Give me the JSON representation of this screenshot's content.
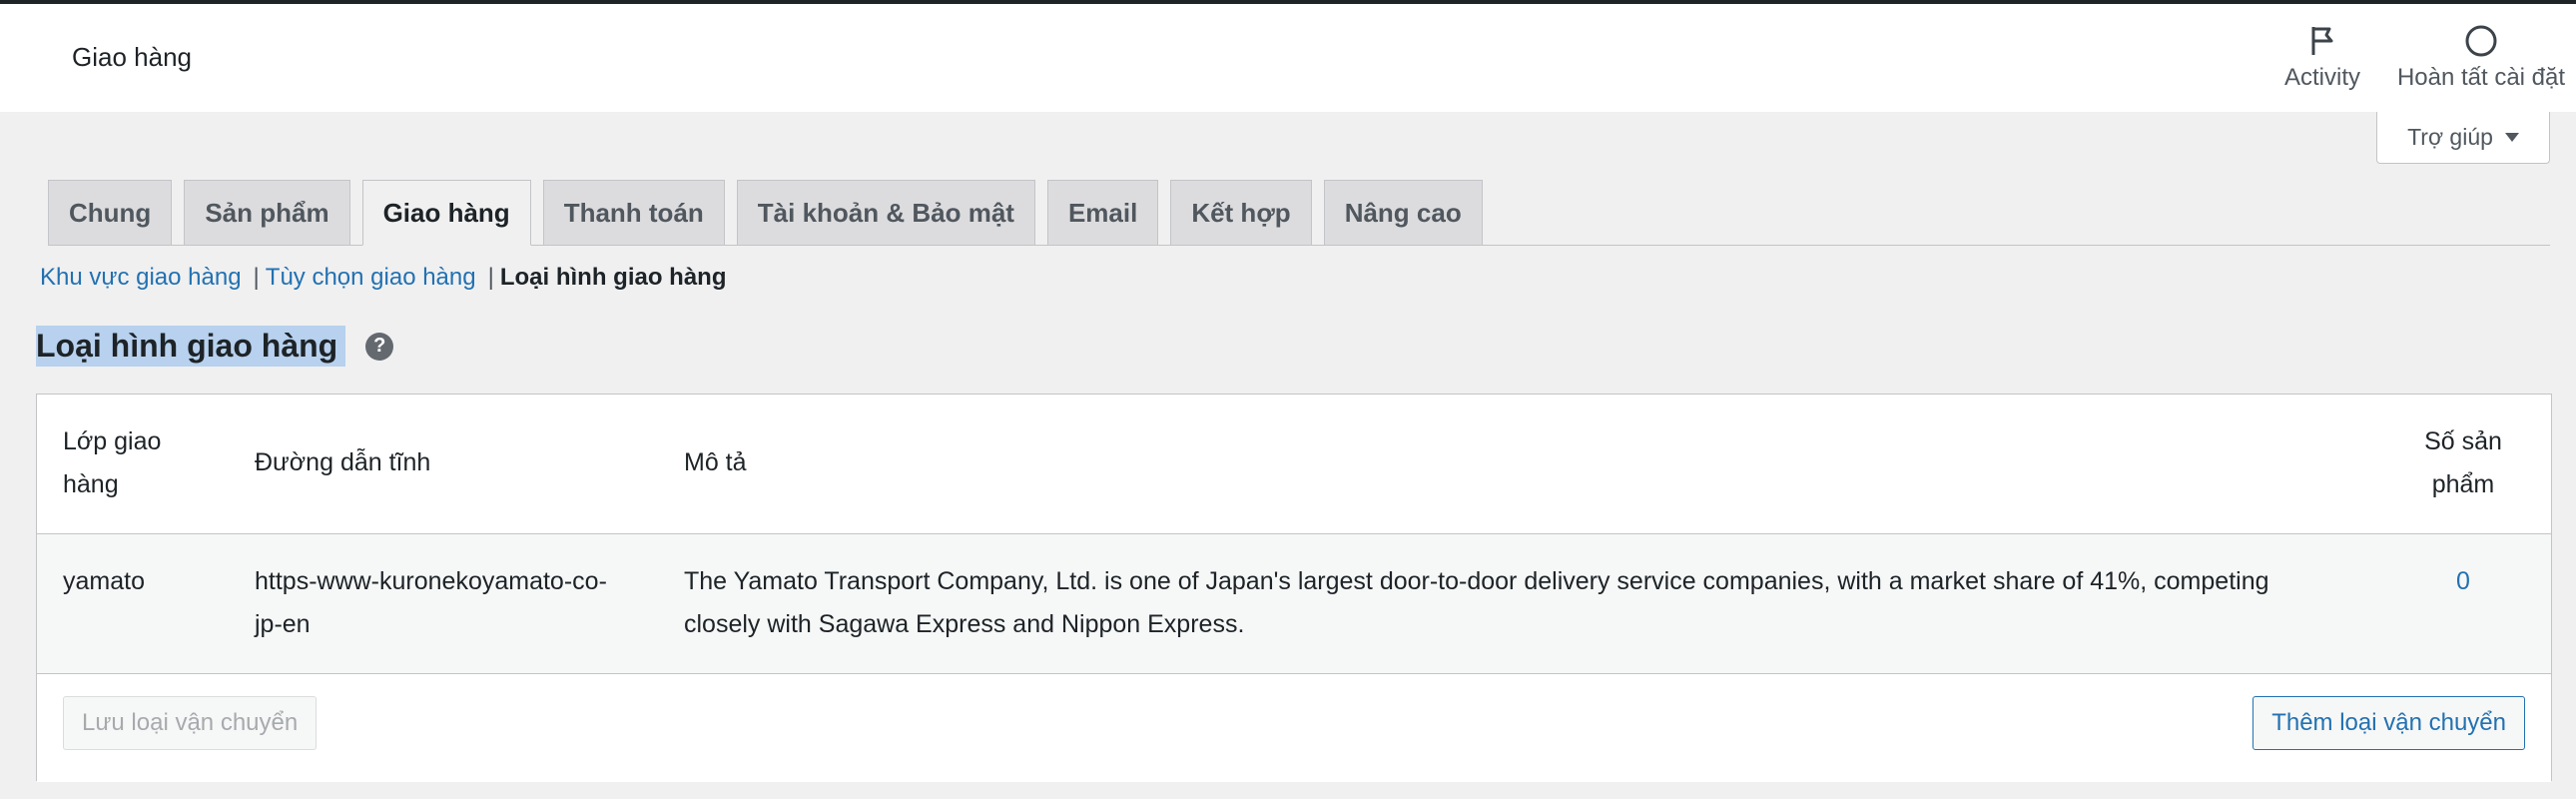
{
  "header": {
    "title": "Giao hàng",
    "activity_label": "Activity",
    "setup_label": "Hoàn tất cài đặt",
    "help_label": "Trợ giúp"
  },
  "tabs": [
    {
      "label": "Chung",
      "active": false
    },
    {
      "label": "Sản phẩm",
      "active": false
    },
    {
      "label": "Giao hàng",
      "active": true
    },
    {
      "label": "Thanh toán",
      "active": false
    },
    {
      "label": "Tài khoản & Bảo mật",
      "active": false
    },
    {
      "label": "Email",
      "active": false
    },
    {
      "label": "Kết hợp",
      "active": false
    },
    {
      "label": "Nâng cao",
      "active": false
    }
  ],
  "subnav": {
    "zones": "Khu vực giao hàng",
    "options": "Tùy chọn giao hàng",
    "classes": "Loại hình giao hàng",
    "separator": "|"
  },
  "page": {
    "heading": "Loại hình giao hàng",
    "help_glyph": "?"
  },
  "table": {
    "columns": {
      "class": "Lớp giao hàng",
      "slug": "Đường dẫn tĩnh",
      "description": "Mô tả",
      "count": "Số sản phẩm"
    },
    "rows": [
      {
        "class": "yamato",
        "slug": "https-www-kuronekoyamato-co-jp-en",
        "description": "The Yamato Transport Company, Ltd. is one of Japan's largest door-to-door delivery service companies, with a market share of 41%, competing closely with Sagawa Express and Nippon Express.",
        "count": "0"
      }
    ],
    "save_button": "Lưu loại vận chuyển",
    "add_button": "Thêm loại vận chuyển"
  },
  "colors": {
    "accent": "#2271b1",
    "background": "#f0f0f1",
    "selection_highlight": "#b7d1ee"
  }
}
